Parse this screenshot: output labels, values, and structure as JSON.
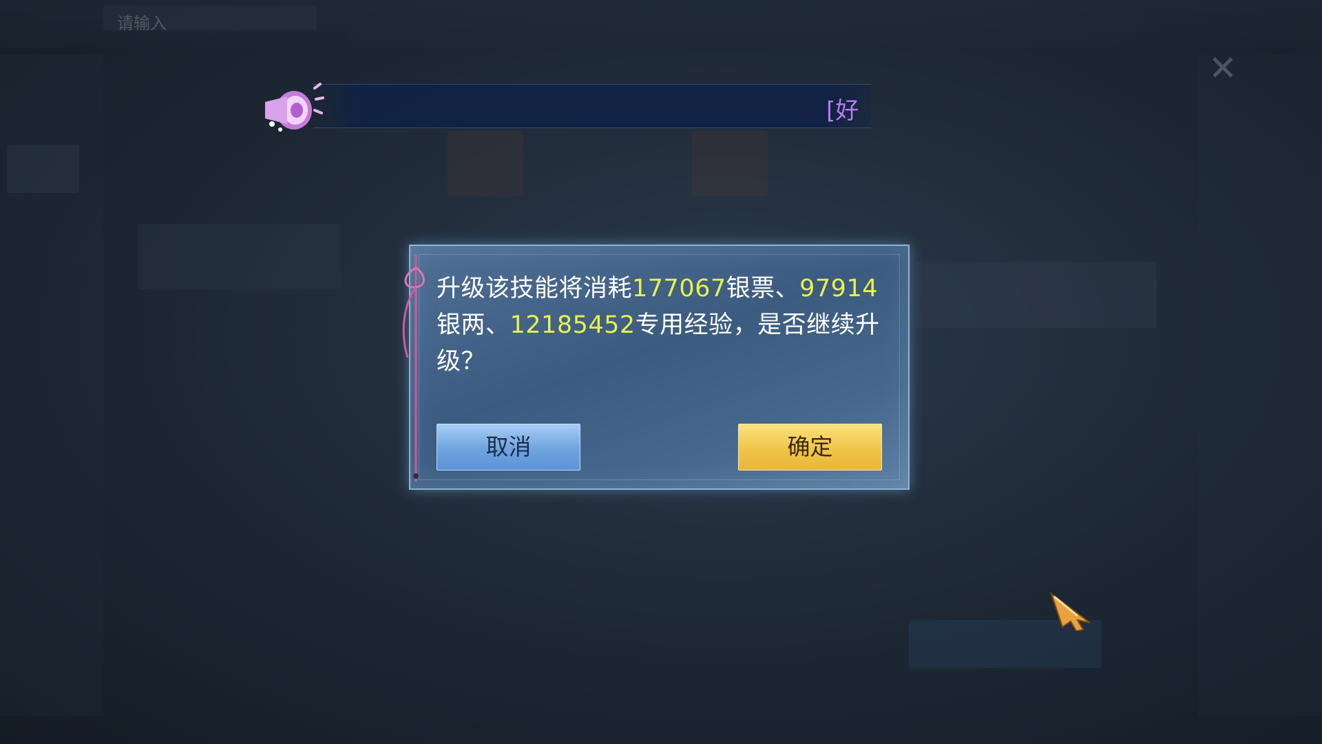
{
  "background": {
    "search_text": "请输入",
    "close_glyph": "✕"
  },
  "marquee": {
    "text": "[好"
  },
  "dialog": {
    "message_prefix": "升级该技能将消耗",
    "silver_ticket": "177067",
    "silver_ticket_unit": "银票、",
    "silver_taels": "97914",
    "silver_taels_unit": "银两、",
    "exp": "12185452",
    "exp_suffix": "专用经验，是否继续升级？",
    "cancel_label": "取消",
    "confirm_label": "确定"
  },
  "colors": {
    "highlight": "#e9f24a",
    "cancel_button": "#6fa4e0",
    "confirm_button": "#f0c54a"
  }
}
